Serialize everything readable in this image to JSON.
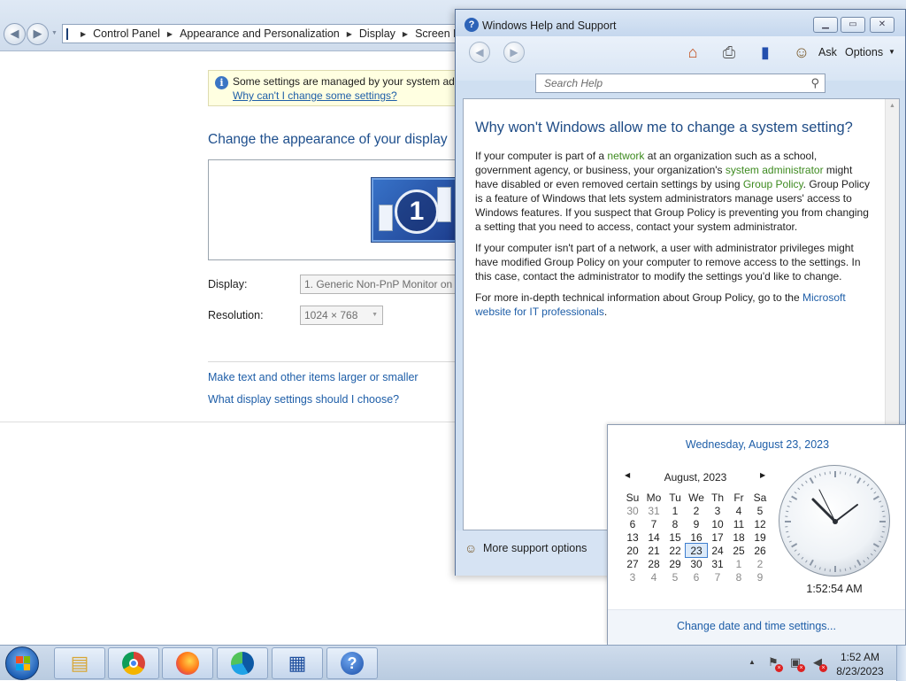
{
  "control_panel": {
    "breadcrumb": [
      "Control Panel",
      "Appearance and Personalization",
      "Display",
      "Screen Res"
    ],
    "info_text": "Some settings are managed by your system adm",
    "info_link": "Why can't I change some settings?",
    "heading": "Change the appearance of your display",
    "monitor_number": "1",
    "display_label": "Display:",
    "display_value": "1. Generic Non-PnP Monitor on",
    "resolution_label": "Resolution:",
    "resolution_value": "1024 × 768",
    "link_text_size": "Make text and other items larger or smaller",
    "link_display_settings": "What display settings should I choose?"
  },
  "help_window": {
    "title": "Windows Help and Support",
    "toolbar": {
      "ask": "Ask",
      "options": "Options"
    },
    "search_placeholder": "Search Help",
    "article_title": "Why won't Windows allow me to change a system setting?",
    "p1": {
      "t1": "If your computer is part of a ",
      "network": "network",
      "t2": " at an organization such as a school, government agency, or business, your organization's ",
      "sysadmin": "system administrator",
      "t3": " might have disabled or even removed certain settings by using ",
      "gp": "Group Policy",
      "t4": ". Group Policy is a feature of Windows that lets system administrators manage users' access to Windows features. If you suspect that Group Policy is preventing you from changing a setting that you need to access, contact your system administrator."
    },
    "p2": "If your computer isn't part of a network, a user with administrator privileges might have modified Group Policy on your computer to remove access to the settings. In this case, contact the administrator to modify the settings you'd like to change.",
    "p3": {
      "t1": "For more in-depth technical information about Group Policy, go to the ",
      "link": "Microsoft website for IT professionals",
      "t2": "."
    },
    "more_support": "More support options"
  },
  "calendar": {
    "long_date": "Wednesday, August 23, 2023",
    "month": "August, 2023",
    "weekdays": [
      "Su",
      "Mo",
      "Tu",
      "We",
      "Th",
      "Fr",
      "Sa"
    ],
    "weeks": [
      [
        "30",
        "31",
        "1",
        "2",
        "3",
        "4",
        "5"
      ],
      [
        "6",
        "7",
        "8",
        "9",
        "10",
        "11",
        "12"
      ],
      [
        "13",
        "14",
        "15",
        "16",
        "17",
        "18",
        "19"
      ],
      [
        "20",
        "21",
        "22",
        "23",
        "24",
        "25",
        "26"
      ],
      [
        "27",
        "28",
        "29",
        "30",
        "31",
        "1",
        "2"
      ],
      [
        "3",
        "4",
        "5",
        "6",
        "7",
        "8",
        "9"
      ]
    ],
    "time": "1:52:54 AM",
    "change_link": "Change date and time settings..."
  },
  "taskbar": {
    "time": "1:52 AM",
    "date": "8/23/2023"
  }
}
